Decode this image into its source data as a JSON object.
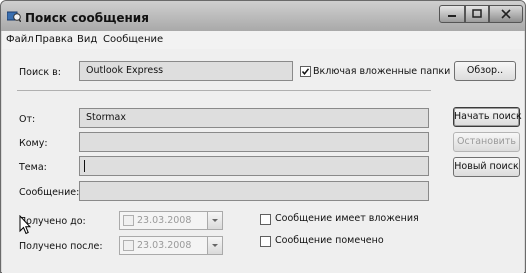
{
  "window": {
    "title": "Поиск сообщения"
  },
  "menu": [
    {
      "label": "Файл"
    },
    {
      "label": "Правка"
    },
    {
      "label": "Вид"
    },
    {
      "label": "Сообщение"
    }
  ],
  "search_in": {
    "label": "Поиск в:",
    "value": "Outlook Express",
    "include_subfolders_label": "Включая вложенные папки",
    "include_subfolders_checked": true,
    "browse_label": "Обзор.."
  },
  "fields": {
    "from_label": "От:",
    "from_value": "Stormax",
    "to_label": "Кому:",
    "to_value": "",
    "subject_label": "Тема:",
    "subject_value": "",
    "message_label": "Сообщение:",
    "message_value": ""
  },
  "buttons": {
    "start_search": "Начать поиск",
    "stop": "Остановить",
    "new_search": "Новый поиск"
  },
  "received_before": {
    "label": "Получено до:",
    "date": "23.03.2008"
  },
  "received_after": {
    "label": "Получено после:",
    "date": "23.03.2008"
  },
  "options": {
    "has_attachments_label": "Сообщение имеет вложения",
    "flagged_label": "Сообщение помечено"
  }
}
